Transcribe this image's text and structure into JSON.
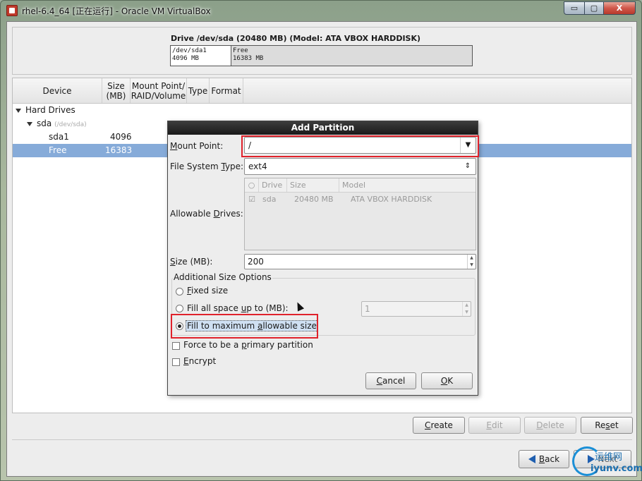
{
  "window": {
    "title": "rhel-6.4_64 [正在运行] - Oracle VM VirtualBox",
    "min": "▭",
    "max": "▢",
    "close": "X"
  },
  "drive": {
    "title": "Drive /dev/sda (20480 MB) (Model: ATA VBOX HARDDISK)",
    "segments": [
      {
        "name": "/dev/sda1",
        "size": "4096 MB"
      },
      {
        "name": "Free",
        "size": "16383 MB"
      }
    ]
  },
  "table": {
    "headers": [
      "Device",
      "Size (MB)",
      "Mount Point/ RAID/Volume",
      "Type",
      "Format"
    ],
    "rows": [
      {
        "label": "Hard Drives"
      },
      {
        "label": "sda",
        "hint": "(/dev/sda)"
      },
      {
        "label": "sda1",
        "size": "4096"
      },
      {
        "label": "Free",
        "size": "16383"
      }
    ]
  },
  "dialog": {
    "title": "Add Partition",
    "mount_label_u": "M",
    "mount_label_rest": "ount Point:",
    "mount_value": "/",
    "fstype_label_a": "File System ",
    "fstype_label_u": "T",
    "fstype_label_b": "ype:",
    "fstype_value": "ext4",
    "drives_label_a": "Allowable ",
    "drives_label_u": "D",
    "drives_label_b": "rives:",
    "drives_headers": [
      "Drive",
      "Size",
      "Model"
    ],
    "drives_row": {
      "drive": "sda",
      "size": "20480 MB",
      "model": "ATA VBOX HARDDISK"
    },
    "size_label_u": "S",
    "size_label_rest": "ize (MB):",
    "size_value": "200",
    "group_title": "Additional Size Options",
    "fixed_u": "F",
    "fixed_rest": "ixed size",
    "fill_upto_a": "Fill all space ",
    "fill_upto_u": "u",
    "fill_upto_b": "p to (MB):",
    "fill_upto_value": "1",
    "fill_max_a": "Fill to maximum ",
    "fill_max_u": "a",
    "fill_max_b": "llowable size",
    "primary_a": "Force to be a ",
    "primary_u": "p",
    "primary_b": "rimary partition",
    "encrypt_u": "E",
    "encrypt_rest": "ncrypt",
    "cancel_u": "C",
    "cancel_rest": "ancel",
    "ok_u": "O",
    "ok_rest": "K"
  },
  "actions": {
    "create_u": "C",
    "create_rest": "reate",
    "edit_u": "E",
    "edit_rest": "dit",
    "delete_u": "D",
    "delete_rest": "elete",
    "reset_a": "Re",
    "reset_u": "s",
    "reset_b": "et"
  },
  "nav": {
    "back_u": "B",
    "back_rest": "ack",
    "next": "Next"
  },
  "watermark": {
    "text": "运维网",
    "url": "iyunv.com"
  }
}
